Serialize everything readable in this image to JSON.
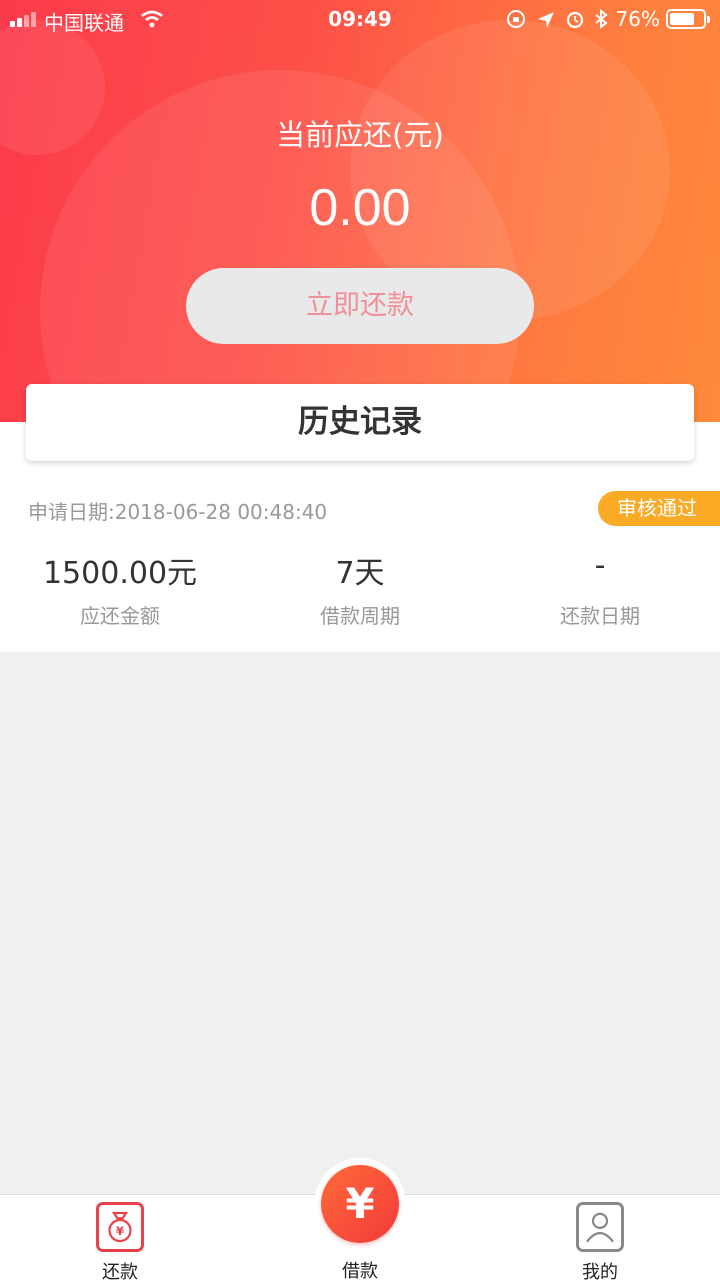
{
  "status_bar": {
    "carrier": "中国联通",
    "time": "09:49",
    "battery_percent": "76%",
    "battery_level": 0.76
  },
  "header": {
    "due_label": "当前应还(元)",
    "due_amount": "0.00",
    "repay_button": "立即还款"
  },
  "history": {
    "title": "历史记录",
    "record": {
      "apply_date": "申请日期:2018-06-28 00:48:40",
      "status": "审核通过",
      "columns": [
        {
          "value": "1500.00元",
          "label": "应还金额"
        },
        {
          "value": "7天",
          "label": "借款周期"
        },
        {
          "value": "-",
          "label": "还款日期"
        }
      ]
    }
  },
  "tabbar": {
    "repay": "还款",
    "borrow": "借款",
    "borrow_symbol": "¥",
    "mine": "我的"
  },
  "colors": {
    "primary_red": "#fb3a4b",
    "primary_orange": "#ff8a3a",
    "badge": "#fbaa26"
  },
  "icons": {
    "tab_repay": "money-bag-icon",
    "tab_mine": "user-profile-icon"
  }
}
